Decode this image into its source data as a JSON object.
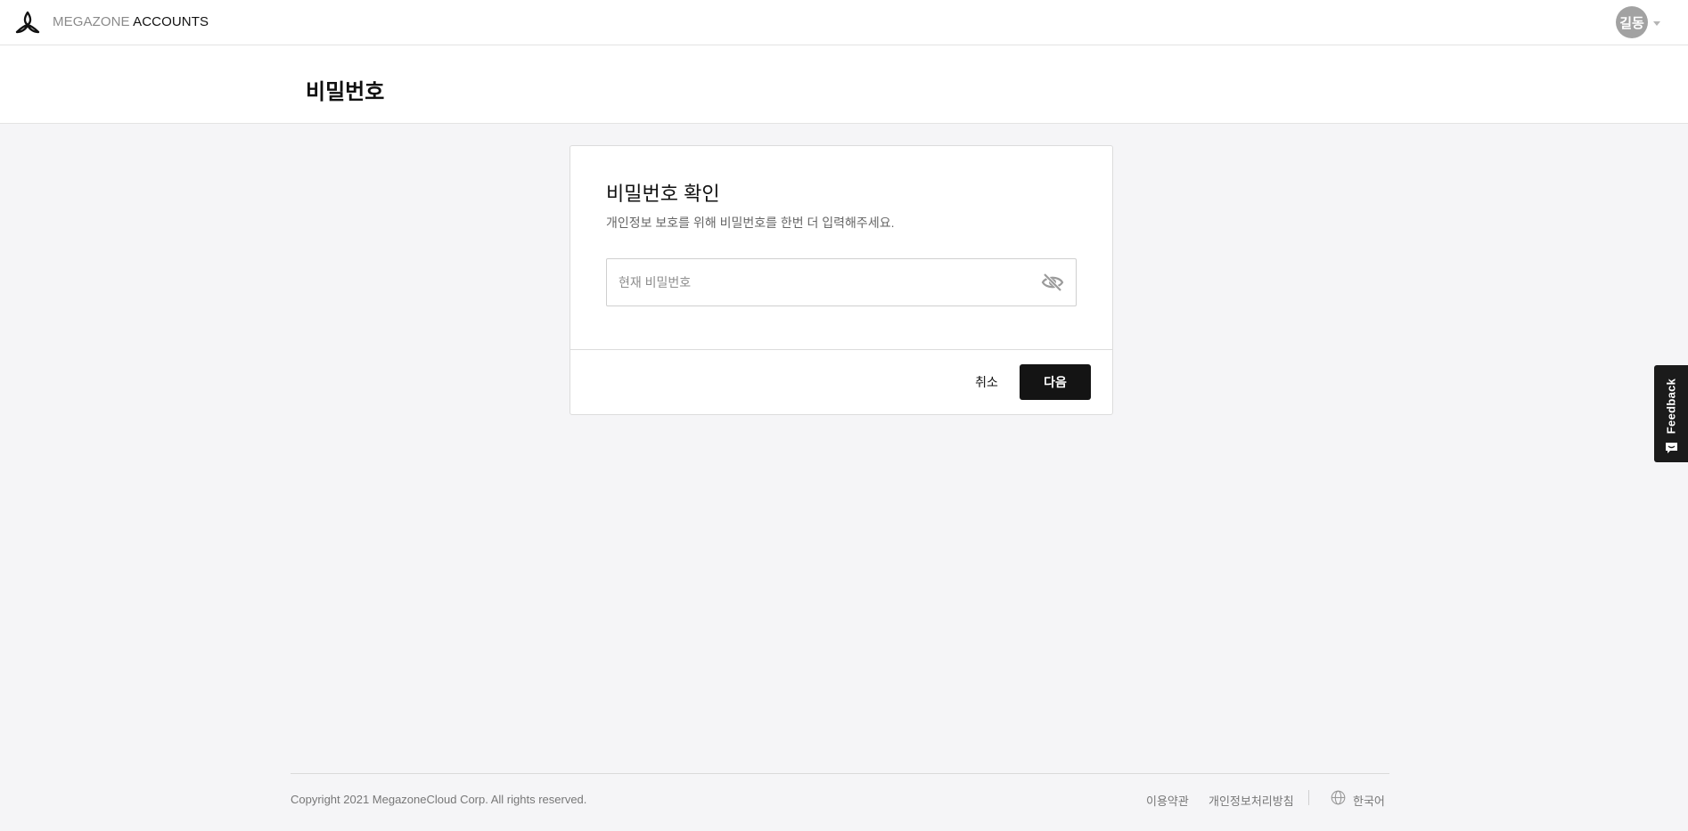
{
  "header": {
    "brand_light": "MEGAZONE",
    "brand_dark": "ACCOUNTS",
    "avatar_text": "길동",
    "logo_icon": "megazone-logo-icon",
    "caret_icon": "chevron-down-icon"
  },
  "page": {
    "title": "비밀번호"
  },
  "card": {
    "title": "비밀번호 확인",
    "description": "개인정보 보호를 위해 비밀번호를 한번 더 입력해주세요.",
    "password_placeholder": "현재 비밀번호",
    "password_value": "",
    "toggle_icon": "eye-off-icon",
    "cancel_label": "취소",
    "next_label": "다음"
  },
  "feedback": {
    "label": "Feedback",
    "icon": "chat-icon"
  },
  "footer": {
    "copyright": "Copyright 2021 MegazoneCloud Corp. All rights reserved.",
    "terms_label": "이용약관",
    "privacy_label": "개인정보처리방침",
    "language_label": "한국어",
    "language_icon": "globe-icon"
  },
  "colors": {
    "primary_button": "#141414",
    "background": "#f5f5f7",
    "avatar": "#a2a2a2"
  }
}
